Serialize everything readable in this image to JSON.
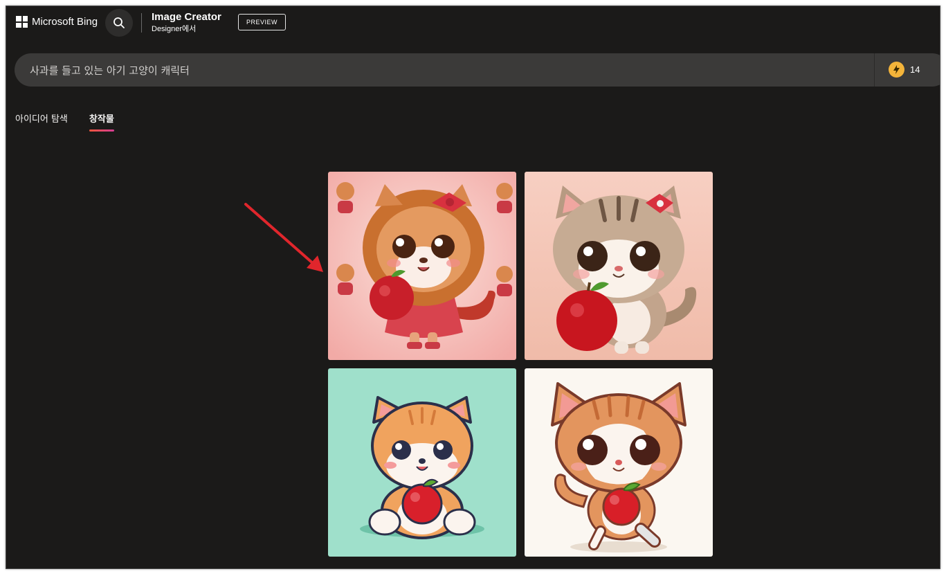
{
  "header": {
    "brand": "Microsoft Bing",
    "app_title": "Image Creator",
    "app_subtitle": "Designer에서",
    "badge": "PREVIEW"
  },
  "prompt": {
    "value": "사과를 들고 있는 아기 고양이 캐릭터",
    "boosts": "14"
  },
  "tabs": [
    {
      "label": "아이디어 탐색",
      "active": false
    },
    {
      "label": "창작물",
      "active": true
    }
  ],
  "images": [
    {
      "name": "Cat with red bow in pink dress holding an apple",
      "background": "#f7c9c4"
    },
    {
      "name": "Tabby cat with red bow holding an apple",
      "background": "#f4c9bd"
    },
    {
      "name": "Cartoon orange cat sitting with an apple",
      "background": "#9fe0cb"
    },
    {
      "name": "Cartoon orange cat walking with an apple",
      "background": "#fbf7f1"
    }
  ],
  "colors": {
    "background": "#1b1a19",
    "prompt_bar": "#3b3a39",
    "accent_start": "#f0553b",
    "accent_end": "#d63d94",
    "coin": "#f4b43a",
    "annotation_arrow": "#e0262c"
  },
  "icons": [
    "windows-logo-icon",
    "search-icon",
    "lightning-coin-icon",
    "red-arrow-annotation"
  ]
}
